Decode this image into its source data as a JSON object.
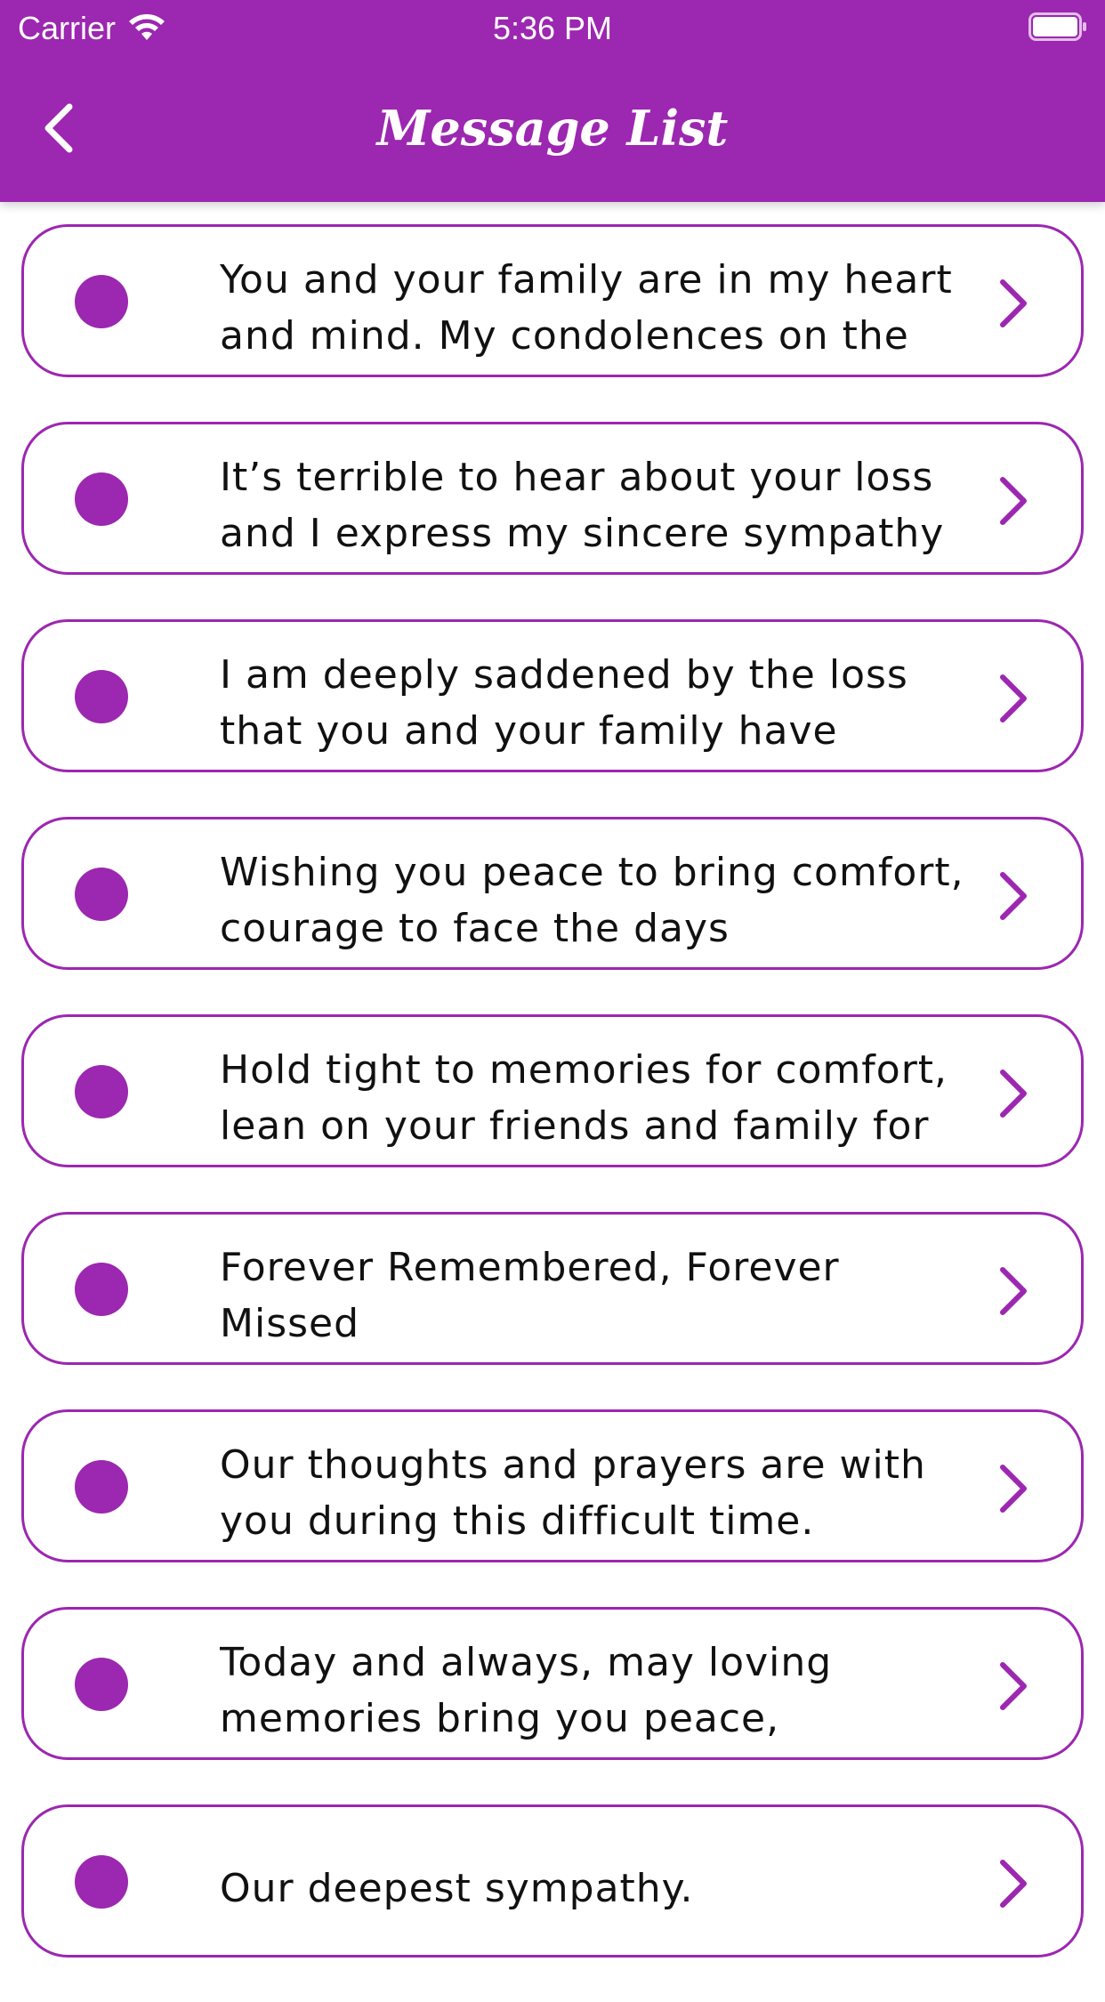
{
  "status_bar": {
    "carrier": "Carrier",
    "time": "5:36 PM",
    "wifi_icon": "wifi-icon",
    "battery_icon": "battery-full-icon"
  },
  "header": {
    "title": "Message List",
    "back_icon": "chevron-left-icon",
    "background_color": "#9c27b0"
  },
  "colors": {
    "accent": "#9c27b0",
    "text": "#111111",
    "background": "#ffffff"
  },
  "messages": [
    {
      "text": "You and your family are in my heart and mind. My condolences on the"
    },
    {
      "text": "It’s terrible to hear about your loss and I express my sincere sympathy"
    },
    {
      "text": "I am deeply saddened by the loss that you and your family have"
    },
    {
      "text": "Wishing you peace to bring comfort, courage to face the days"
    },
    {
      "text": "Hold tight to memories for comfort, lean on your friends and family for"
    },
    {
      "text": "Forever Remembered, Forever Missed"
    },
    {
      "text": "Our thoughts and prayers are with you during this difficult time."
    },
    {
      "text": "Today and always, may loving memories bring you peace,"
    },
    {
      "text": "Our deepest sympathy."
    }
  ]
}
